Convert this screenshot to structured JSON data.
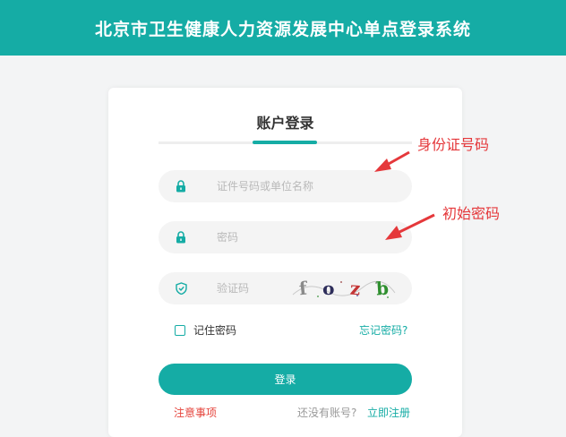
{
  "header": {
    "title": "北京市卫生健康人力资源发展中心单点登录系统"
  },
  "login": {
    "tab_title": "账户登录",
    "id_placeholder": "证件号码或单位名称",
    "password_placeholder": "密码",
    "captcha_placeholder": "验证码",
    "captcha_text": [
      "f",
      "o",
      "z",
      "b"
    ],
    "remember_label": "记住密码",
    "forgot_label": "忘记密码?",
    "login_button": "登录",
    "notice_label": "注意事项",
    "no_account_label": "还没有账号?",
    "register_label": "立即注册"
  },
  "annotations": {
    "id_hint": "身份证号码",
    "password_hint": "初始密码"
  },
  "colors": {
    "brand": "#15aca5",
    "annotation_red": "#e5383b",
    "notice_red": "#e5443c"
  }
}
